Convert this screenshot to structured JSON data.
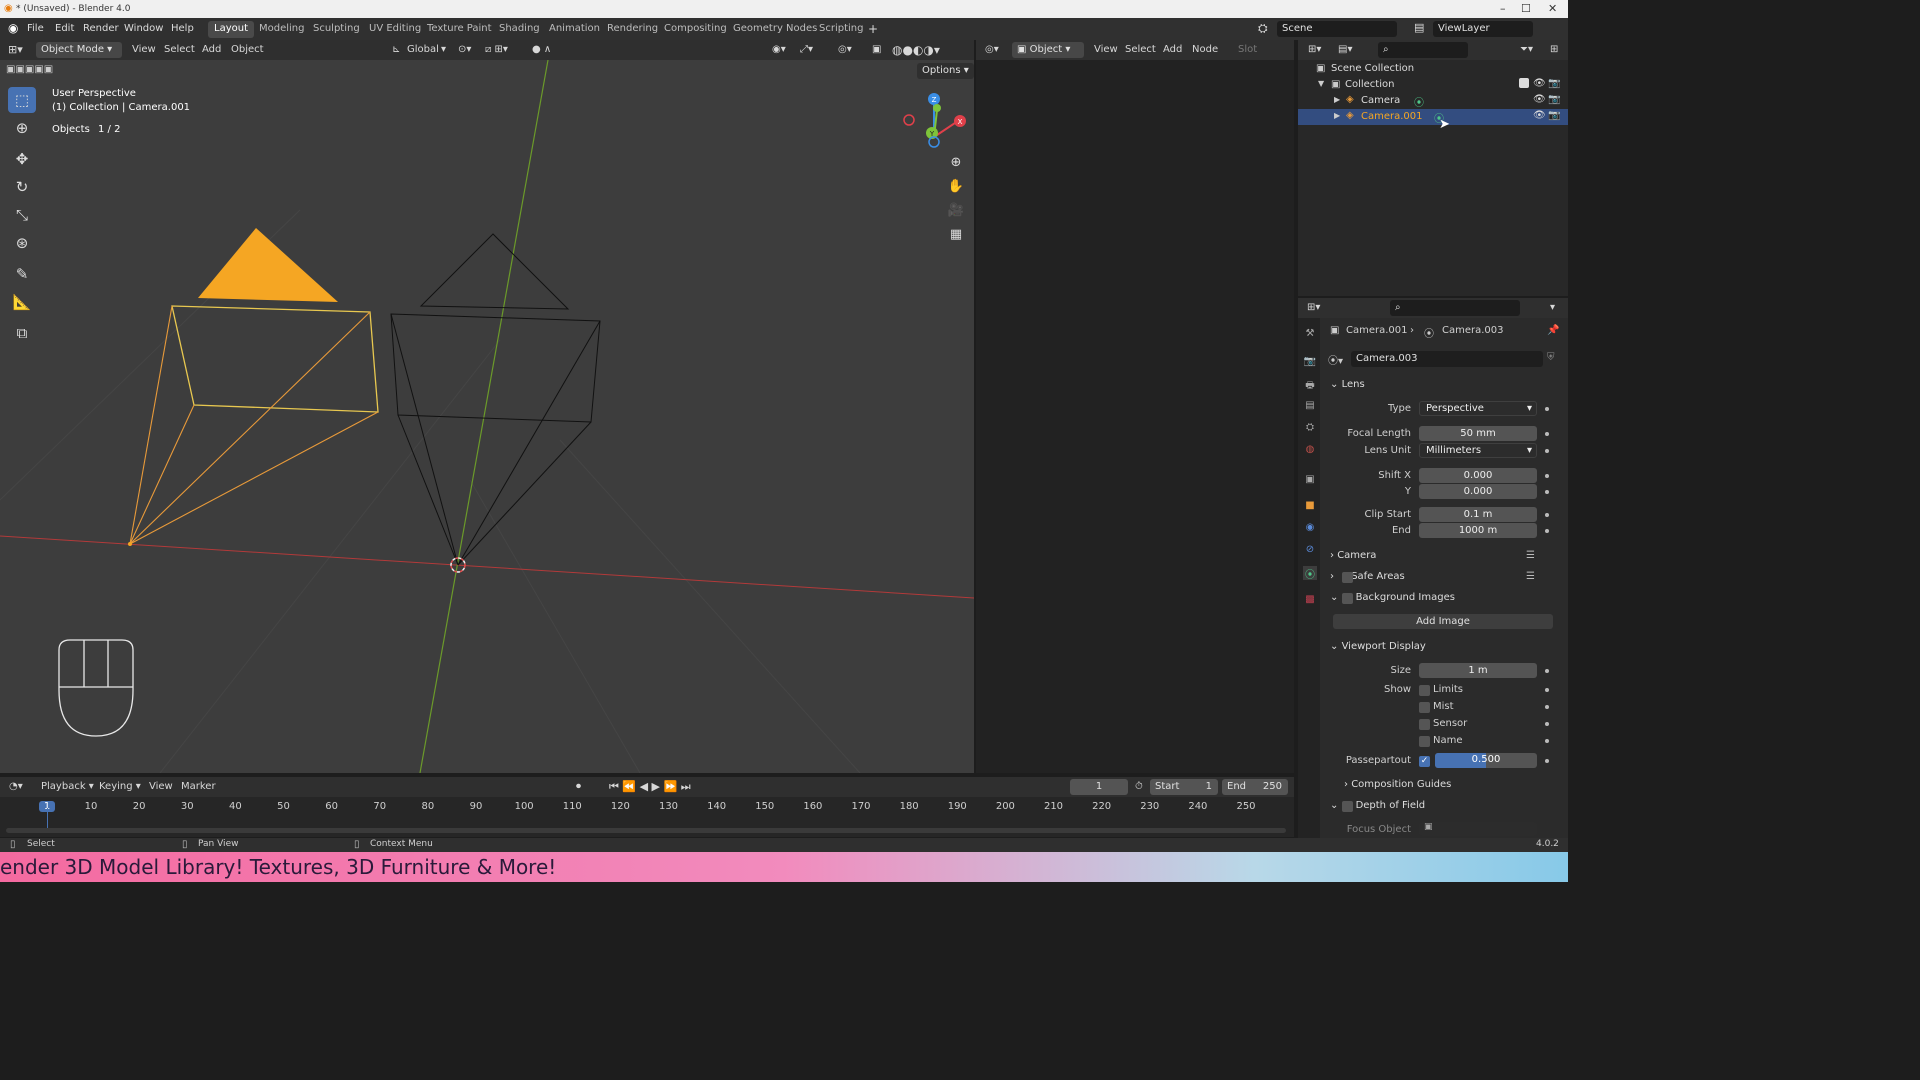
{
  "window": {
    "title": "* (Unsaved) - Blender 4.0"
  },
  "menubar": {
    "menus": [
      "File",
      "Edit",
      "Render",
      "Window",
      "Help"
    ],
    "workspaces": [
      "Layout",
      "Modeling",
      "Sculpting",
      "UV Editing",
      "Texture Paint",
      "Shading",
      "Animation",
      "Rendering",
      "Compositing",
      "Geometry Nodes",
      "Scripting"
    ],
    "scene": "Scene",
    "view_layer": "ViewLayer"
  },
  "viewport": {
    "mode": "Object Mode",
    "menus": [
      "View",
      "Select",
      "Add",
      "Object"
    ],
    "orientation": "Global",
    "options": "Options",
    "overlay_title": "User Perspective",
    "overlay_collection": "(1) Collection | Camera.001",
    "objects_label": "Objects",
    "objects_count": "1 / 2",
    "gizmo_z": "Z",
    "gizmo_x": "X",
    "gizmo_y": "Y"
  },
  "shader_editor": {
    "type": "Object",
    "menus": [
      "View",
      "Select",
      "Add",
      "Node"
    ],
    "slot": "Slot"
  },
  "outliner": {
    "root": "Scene Collection",
    "collection": "Collection",
    "items": [
      "Camera",
      "Camera.001"
    ]
  },
  "properties": {
    "breadcrumb_object": "Camera.001",
    "breadcrumb_data": "Camera.003",
    "datablock": "Camera.003",
    "lens_section": "Lens",
    "type_label": "Type",
    "type_value": "Perspective",
    "focal_label": "Focal Length",
    "focal_value": "50 mm",
    "lensunit_label": "Lens Unit",
    "lensunit_value": "Millimeters",
    "shiftx_label": "Shift X",
    "shiftx_value": "0.000",
    "shifty_label": "Y",
    "shifty_value": "0.000",
    "clipstart_label": "Clip Start",
    "clipstart_value": "0.1 m",
    "clipend_label": "End",
    "clipend_value": "1000 m",
    "camera_section": "Camera",
    "safe_section": "Safe Areas",
    "bg_section": "Background Images",
    "add_image": "Add Image",
    "vpd_section": "Viewport Display",
    "size_label": "Size",
    "size_value": "1 m",
    "show_label": "Show",
    "show_items": [
      "Limits",
      "Mist",
      "Sensor",
      "Name"
    ],
    "passepartout_label": "Passepartout",
    "passepartout_value": "0.500",
    "guides_section": "Composition Guides",
    "dof_section": "Depth of Field",
    "focus_label": "Focus Object"
  },
  "timeline": {
    "menus": [
      "Playback",
      "Keying",
      "View",
      "Marker"
    ],
    "current_frame": "1",
    "start_label": "Start",
    "start_value": "1",
    "end_label": "End",
    "end_value": "250",
    "ticks": [
      "1",
      "10",
      "20",
      "30",
      "40",
      "50",
      "60",
      "70",
      "80",
      "90",
      "100",
      "110",
      "120",
      "130",
      "140",
      "150",
      "160",
      "170",
      "180",
      "190",
      "200",
      "210",
      "220",
      "230",
      "240",
      "250"
    ]
  },
  "statusbar": {
    "select": "Select",
    "pan": "Pan View",
    "context": "Context Menu",
    "version": "4.0.2"
  },
  "banner": {
    "text": "ender 3D Model Library! Textures, 3D Furniture & More!"
  },
  "colors": {
    "accent": "#4772b3",
    "selected_camera": "#f5a623",
    "x_axis": "#e0404a",
    "y_axis": "#7ec43a",
    "z_axis": "#3a8ee6"
  }
}
